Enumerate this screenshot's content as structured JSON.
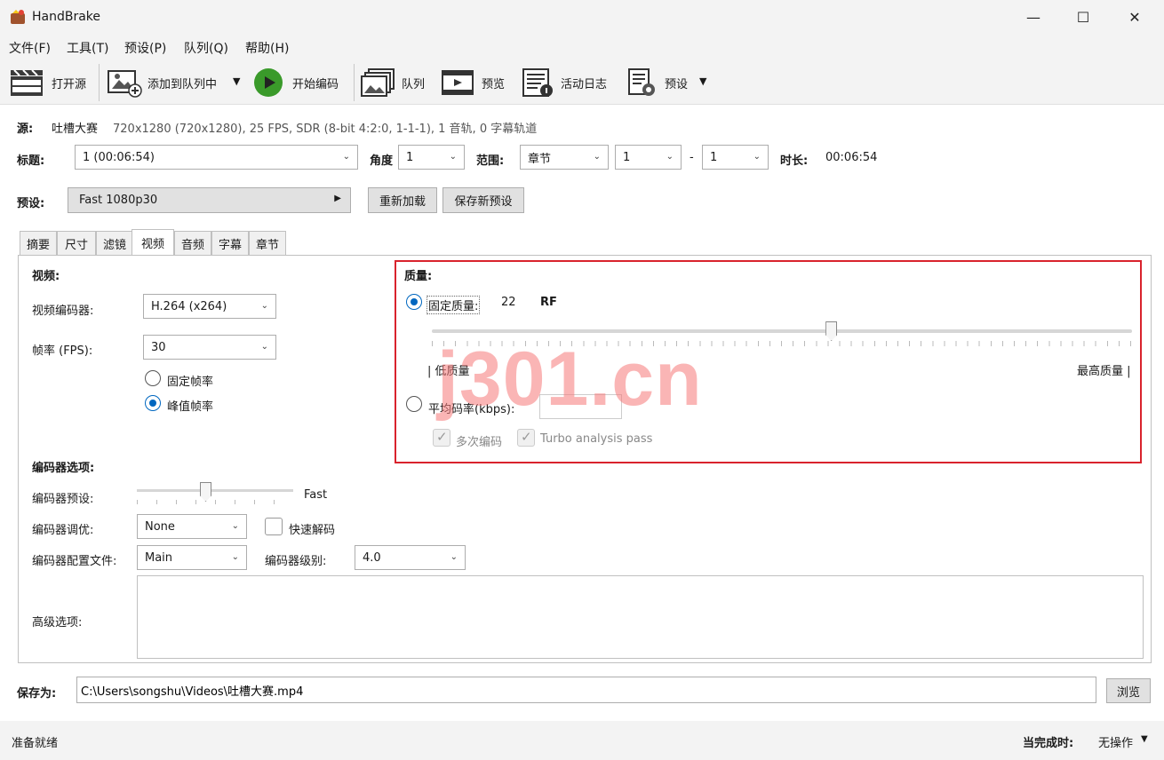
{
  "window": {
    "title": "HandBrake",
    "minimize": "—",
    "maximize": "☐",
    "close": "✕"
  },
  "menu": [
    "文件(F)",
    "工具(T)",
    "预设(P)",
    "队列(Q)",
    "帮助(H)"
  ],
  "toolbar": {
    "open_source": "打开源",
    "add_to_queue": "添加到队列中",
    "start_encode": "开始编码",
    "queue": "队列",
    "preview": "预览",
    "activity_log": "活动日志",
    "presets": "预设"
  },
  "source": {
    "label": "源:",
    "name": "吐槽大赛",
    "info": "720x1280 (720x1280), 25 FPS, SDR (8-bit 4:2:0, 1-1-1), 1 音轨, 0 字幕轨道"
  },
  "title_row": {
    "title_label": "标题:",
    "title_value": "1  (00:06:54)",
    "angle_label": "角度",
    "angle_value": "1",
    "range_label": "范围:",
    "range_type": "章节",
    "range_start": "1",
    "range_dash": "-",
    "range_end": "1",
    "duration_label": "时长:",
    "duration_value": "00:06:54"
  },
  "preset_row": {
    "label": "预设:",
    "value": "Fast 1080p30",
    "reload": "重新加载",
    "save_new": "保存新预设"
  },
  "tabs": [
    "摘要",
    "尺寸",
    "滤镜",
    "视频",
    "音频",
    "字幕",
    "章节"
  ],
  "video": {
    "section": "视频:",
    "encoder_label": "视频编码器:",
    "encoder_value": "H.264 (x264)",
    "fps_label": "帧率 (FPS):",
    "fps_value": "30",
    "cfr": "固定帧率",
    "pfr": "峰值帧率"
  },
  "quality": {
    "section": "质量:",
    "cq_label": "固定质量:",
    "cq_value": "22",
    "cq_unit": "RF",
    "low": "| 低质量",
    "high": "最高质量 |",
    "slider_level": 0.57,
    "abr_label": "平均码率(kbps):",
    "abr_value": "",
    "multipass": "多次编码",
    "turbo": "Turbo analysis pass"
  },
  "encoder_opts": {
    "section": "编码器选项:",
    "preset_label": "编码器预设:",
    "preset_value": "Fast",
    "tune_label": "编码器调优:",
    "tune_value": "None",
    "fast_decode": "快速解码",
    "profile_label": "编码器配置文件:",
    "profile_value": "Main",
    "level_label": "编码器级别:",
    "level_value": "4.0",
    "advanced_label": "高级选项:"
  },
  "save": {
    "label": "保存为:",
    "path": "C:\\Users\\songshu\\Videos\\吐槽大赛.mp4",
    "browse": "浏览"
  },
  "status": {
    "ready": "准备就绪",
    "on_done_label": "当完成时:",
    "on_done_value": "无操作"
  },
  "watermark": "j301.cn",
  "colors": {
    "accent": "#0067c0",
    "highlight": "#d9232d",
    "play": "#3a9a2a"
  }
}
